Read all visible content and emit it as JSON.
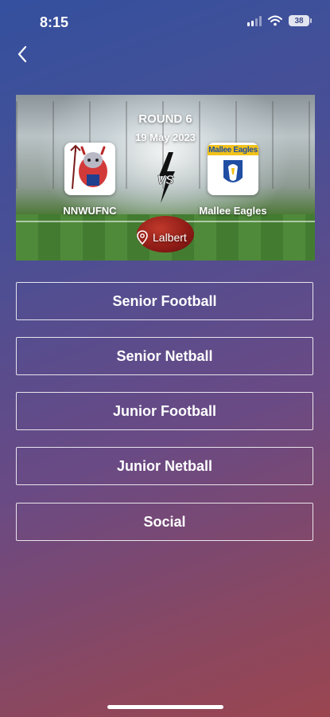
{
  "status_bar": {
    "time": "8:15",
    "battery": "38"
  },
  "nav": {
    "back_icon": "chevron-left-icon"
  },
  "match": {
    "round": "ROUND 6",
    "date": "19 May 2023",
    "home_team": "NNWUFNC",
    "away_team": "Mallee Eagles",
    "away_logo_text": "Mallee Eagles",
    "venue": "Lalbert",
    "vs_icon": "versus-icon",
    "venue_icon": "location-pin-icon"
  },
  "menu": {
    "items": [
      {
        "label": "Senior Football"
      },
      {
        "label": "Senior Netball"
      },
      {
        "label": "Junior Football"
      },
      {
        "label": "Junior Netball"
      },
      {
        "label": "Social"
      }
    ]
  },
  "colors": {
    "accent_text": "#ffffff",
    "ball_red": "#8e1b16",
    "logo_yellow": "#f2c21a",
    "logo_blue": "#1f4ea3"
  }
}
